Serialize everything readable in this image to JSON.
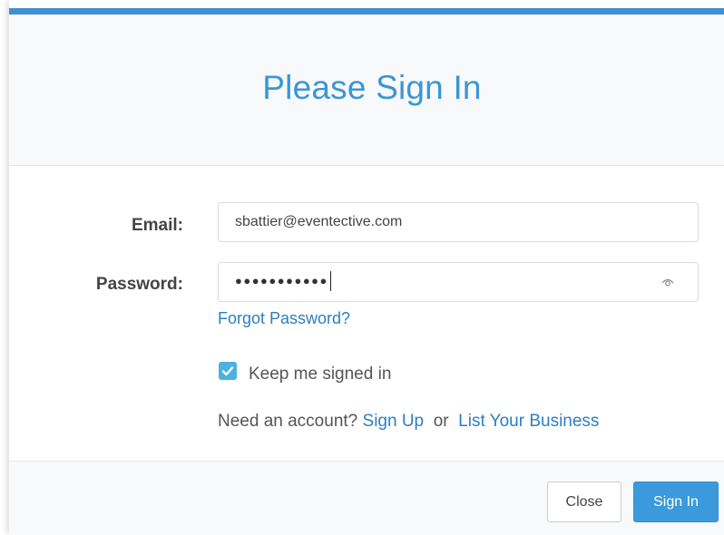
{
  "header": {
    "title": "Please Sign In"
  },
  "form": {
    "email_label": "Email:",
    "email_value": "sbattier@eventective.com",
    "password_label": "Password:",
    "password_masked": "●●●●●●●●●●●",
    "forgot_password": "Forgot Password?",
    "keep_signed_in_label": "Keep me signed in",
    "keep_signed_in_checked": true,
    "account_prompt": "Need an account?",
    "sign_up_link": "Sign Up",
    "or_text": "or",
    "list_business_link": "List Your Business"
  },
  "footer": {
    "close_label": "Close",
    "sign_in_label": "Sign In"
  },
  "colors": {
    "accent": "#3a96d6",
    "link": "#2c7fbe",
    "checkbox": "#4ab3df",
    "primary_button": "#3a9adc",
    "top_bar": "#3f8fd2"
  },
  "icons": {
    "password_visibility": "eye-icon",
    "checkbox_mark": "check-icon"
  }
}
